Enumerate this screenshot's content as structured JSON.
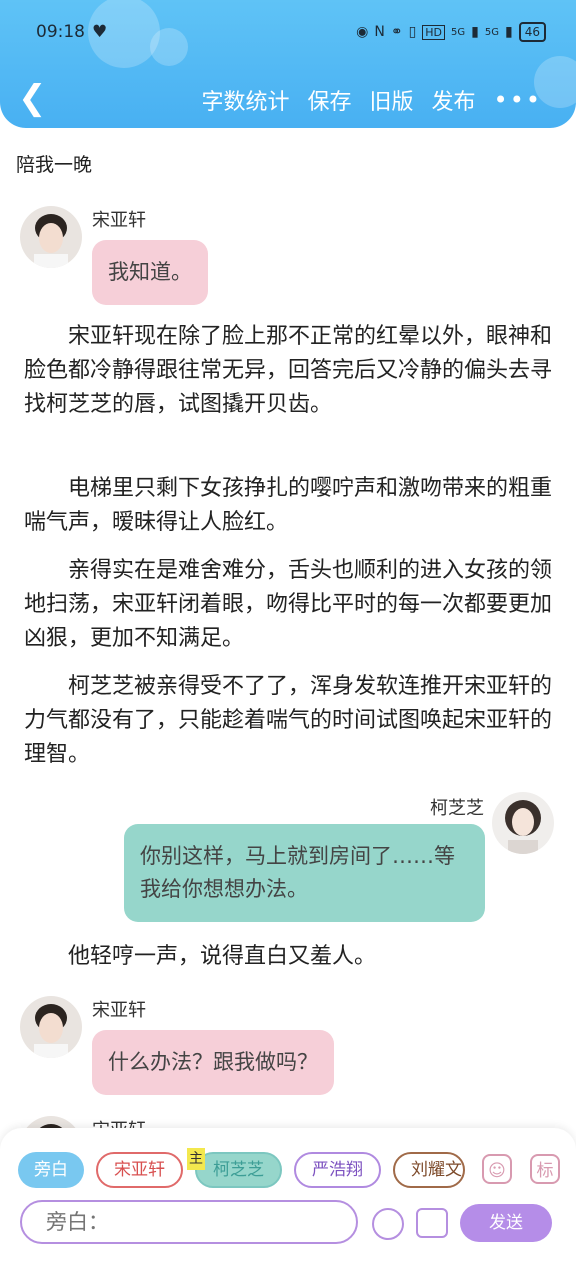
{
  "status_bar": {
    "time": "09:18",
    "heart_icon": "heart-shield-icon",
    "network_1": "5G",
    "network_2": "5G",
    "hd_label": "HD",
    "battery": "46"
  },
  "nav": {
    "back_icon": "chevron-left-icon",
    "word_count": "字数统计",
    "save": "保存",
    "old_version": "旧版",
    "publish": "发布",
    "more_icon": "more-dots-icon"
  },
  "chapter_title": "陪我一晚",
  "messages": [
    {
      "speaker": "宋亚轩",
      "text": "我知道。"
    },
    {
      "speaker": "柯芝芝",
      "text": "你别这样，马上就到房间了……等我给你想想办法。"
    },
    {
      "speaker": "宋亚轩",
      "text": "什么办法？跟我做吗？"
    },
    {
      "speaker": "宋亚轩",
      "text": ""
    }
  ],
  "paragraphs": [
    "宋亚轩现在除了脸上那不正常的红晕以外，眼神和脸色都冷静得跟往常无异，回答完后又冷静的偏头去寻找柯芝芝的唇，试图撬开贝齿。",
    "电梯里只剩下女孩挣扎的嘤咛声和激吻带来的粗重喘气声，暧昧得让人脸红。",
    "亲得实在是难舍难分，舌头也顺利的进入女孩的领地扫荡，宋亚轩闭着眼，吻得比平时的每一次都要更加凶狠，更加不知满足。",
    "柯芝芝被亲得受不了了，浑身发软连推开宋亚轩的力气都没有了，只能趁着喘气的时间试图唤起宋亚轩的理智。",
    "他轻哼一声，说得直白又羞人。"
  ],
  "composer": {
    "roles": [
      "旁白",
      "宋亚轩",
      "柯芝芝",
      "严浩翔",
      "刘耀文"
    ],
    "main_badge": "主",
    "active_role": "旁白",
    "input_placeholder": "旁白：",
    "send": "发送",
    "person_icon": "person-card-icon",
    "mark_icon": "mark-tag-icon",
    "mark_label": "标",
    "emoji_icon": "emoji-smile-icon",
    "image_icon": "image-picture-icon"
  },
  "colors": {
    "header": "#48b0f2",
    "pink_bubble": "#f6cfd8",
    "teal_bubble": "#96d6cb",
    "send_button": "#b58de8"
  }
}
